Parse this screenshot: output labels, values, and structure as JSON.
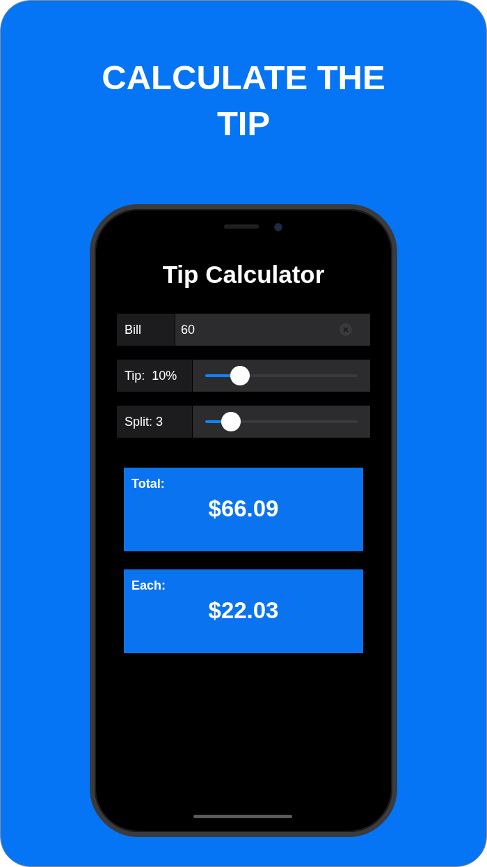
{
  "headline": "CALCULATE THE TIP",
  "app": {
    "title": "Tip Calculator",
    "bill": {
      "label": "Bill",
      "value": "60"
    },
    "sliders": [
      {
        "label": "Tip:  10%",
        "level": 0.23
      },
      {
        "label": "Split: 3",
        "level": 0.17
      }
    ],
    "results": [
      {
        "label": "Total:",
        "value": "$66.09"
      },
      {
        "label": "Each:",
        "value": "$22.03"
      }
    ]
  }
}
